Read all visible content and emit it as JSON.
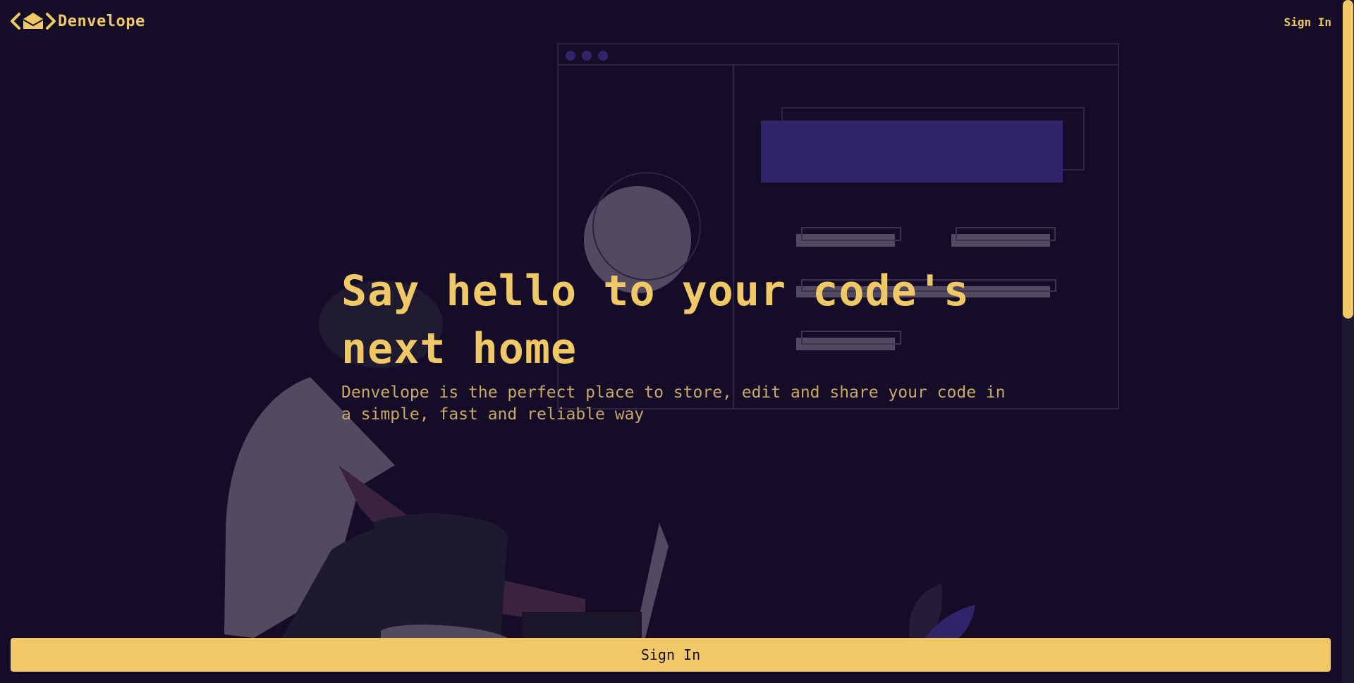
{
  "brand": {
    "name": "Denvelope"
  },
  "nav": {
    "signin_label": "Sign In"
  },
  "hero": {
    "title_line1": "Say hello to your code's",
    "title_line2": "next home",
    "subtitle": "Denvelope is the perfect place to store, edit and share your code in a simple, fast and reliable way"
  },
  "cta": {
    "label": "Sign In"
  },
  "colors": {
    "background": "#150c27",
    "accent": "#f0c866",
    "illustration_purple": "#30256a",
    "illustration_gray": "#534a62"
  },
  "icons": [
    "envelope-code-logo-icon"
  ]
}
